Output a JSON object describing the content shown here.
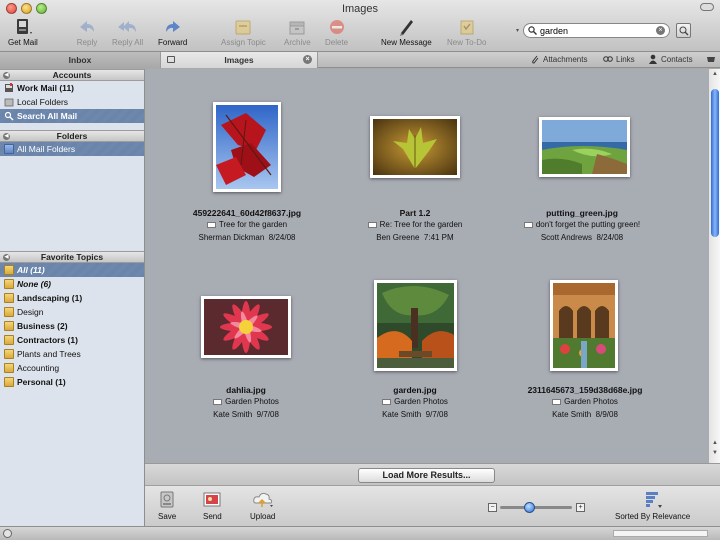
{
  "window": {
    "title": "Images"
  },
  "toolbar": {
    "get_mail": "Get Mail",
    "reply": "Reply",
    "reply_all": "Reply All",
    "forward": "Forward",
    "assign_topic": "Assign Topic",
    "archive": "Archive",
    "delete": "Delete",
    "new_message": "New Message",
    "new_todo": "New To-Do",
    "search_value": "garden"
  },
  "tabs": {
    "inbox": "Inbox",
    "images": "Images",
    "tools": {
      "attachments": "Attachments",
      "links": "Links",
      "contacts": "Contacts"
    }
  },
  "sidebar": {
    "accounts_header": "Accounts",
    "accounts": [
      {
        "label": "Work Mail (11)"
      },
      {
        "label": "Local Folders"
      },
      {
        "label": "Search All Mail"
      }
    ],
    "folders_header": "Folders",
    "folders": [
      {
        "label": "All Mail Folders"
      }
    ],
    "topics_header": "Favorite Topics",
    "topics": [
      {
        "label": "All (11)"
      },
      {
        "label": "None (6)"
      },
      {
        "label": "Landscaping (1)"
      },
      {
        "label": "Design"
      },
      {
        "label": "Business (2)"
      },
      {
        "label": "Contractors (1)"
      },
      {
        "label": "Plants and Trees"
      },
      {
        "label": "Accounting"
      },
      {
        "label": "Personal (1)"
      }
    ]
  },
  "results": [
    {
      "filename": "459222641_60d42f8637.jpg",
      "subject": "Tree for the garden",
      "sender": "Sherman Dickman",
      "date": "8/24/08"
    },
    {
      "filename": "Part 1.2",
      "subject": "Re: Tree for the garden",
      "sender": "Ben Greene",
      "date": "7:41 PM"
    },
    {
      "filename": "putting_green.jpg",
      "subject": "don't forget the putting green!",
      "sender": "Scott Andrews",
      "date": "8/24/08"
    },
    {
      "filename": "dahlia.jpg",
      "subject": "Garden Photos",
      "sender": "Kate Smith",
      "date": "9/7/08"
    },
    {
      "filename": "garden.jpg",
      "subject": "Garden Photos",
      "sender": "Kate Smith",
      "date": "9/7/08"
    },
    {
      "filename": "2311645673_159d38d68e.jpg",
      "subject": "Garden Photos",
      "sender": "Kate Smith",
      "date": "8/9/08"
    }
  ],
  "load_more": "Load More Results...",
  "bottom": {
    "save": "Save",
    "send": "Send",
    "upload": "Upload",
    "sorted_by": "Sorted By Relevance",
    "zoom_level": 0.4
  }
}
